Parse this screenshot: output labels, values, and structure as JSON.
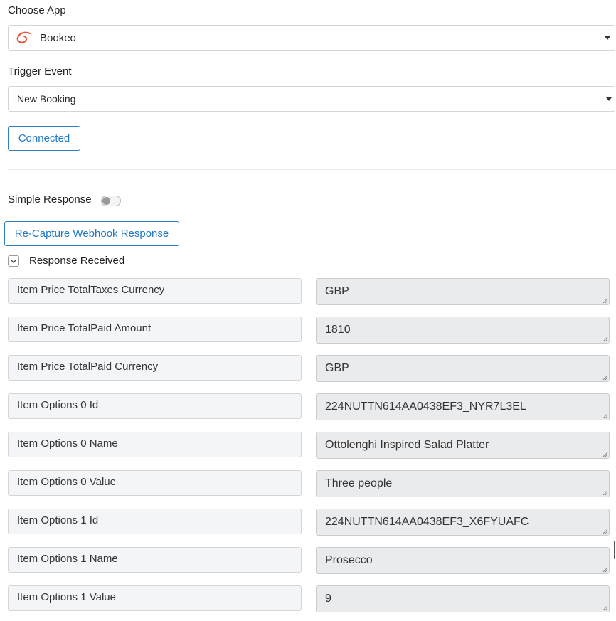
{
  "choose_app": {
    "label": "Choose App",
    "selected": "Bookeo",
    "logo_icon": "bookeo-logo-icon",
    "logo_color": "#e8532f"
  },
  "trigger_event": {
    "label": "Trigger Event",
    "selected": "New Booking"
  },
  "connection": {
    "button_label": "Connected"
  },
  "simple_response": {
    "label": "Simple Response",
    "enabled": false
  },
  "recapture": {
    "button_label": "Re-Capture Webhook Response"
  },
  "response_received": {
    "label": "Response Received",
    "expanded": true
  },
  "fields": [
    {
      "key": "Item Price TotalTaxes Currency",
      "value": "GBP"
    },
    {
      "key": "Item Price TotalPaid Amount",
      "value": "1810"
    },
    {
      "key": "Item Price TotalPaid Currency",
      "value": "GBP"
    },
    {
      "key": "Item Options 0 Id",
      "value": "224NUTTN614AA0438EF3_NYR7L3EL"
    },
    {
      "key": "Item Options 0 Name",
      "value": "Ottolenghi Inspired Salad Platter"
    },
    {
      "key": "Item Options 0 Value",
      "value": "Three people"
    },
    {
      "key": "Item Options 1 Id",
      "value": "224NUTTN614AA0438EF3_X6FYUAFC"
    },
    {
      "key": "Item Options 1 Name",
      "value": "Prosecco"
    },
    {
      "key": "Item Options 1 Value",
      "value": "9"
    }
  ],
  "colors": {
    "accent": "#1f7ac6",
    "field_bg": "#f3f5f7",
    "value_bg": "#eaebed"
  }
}
